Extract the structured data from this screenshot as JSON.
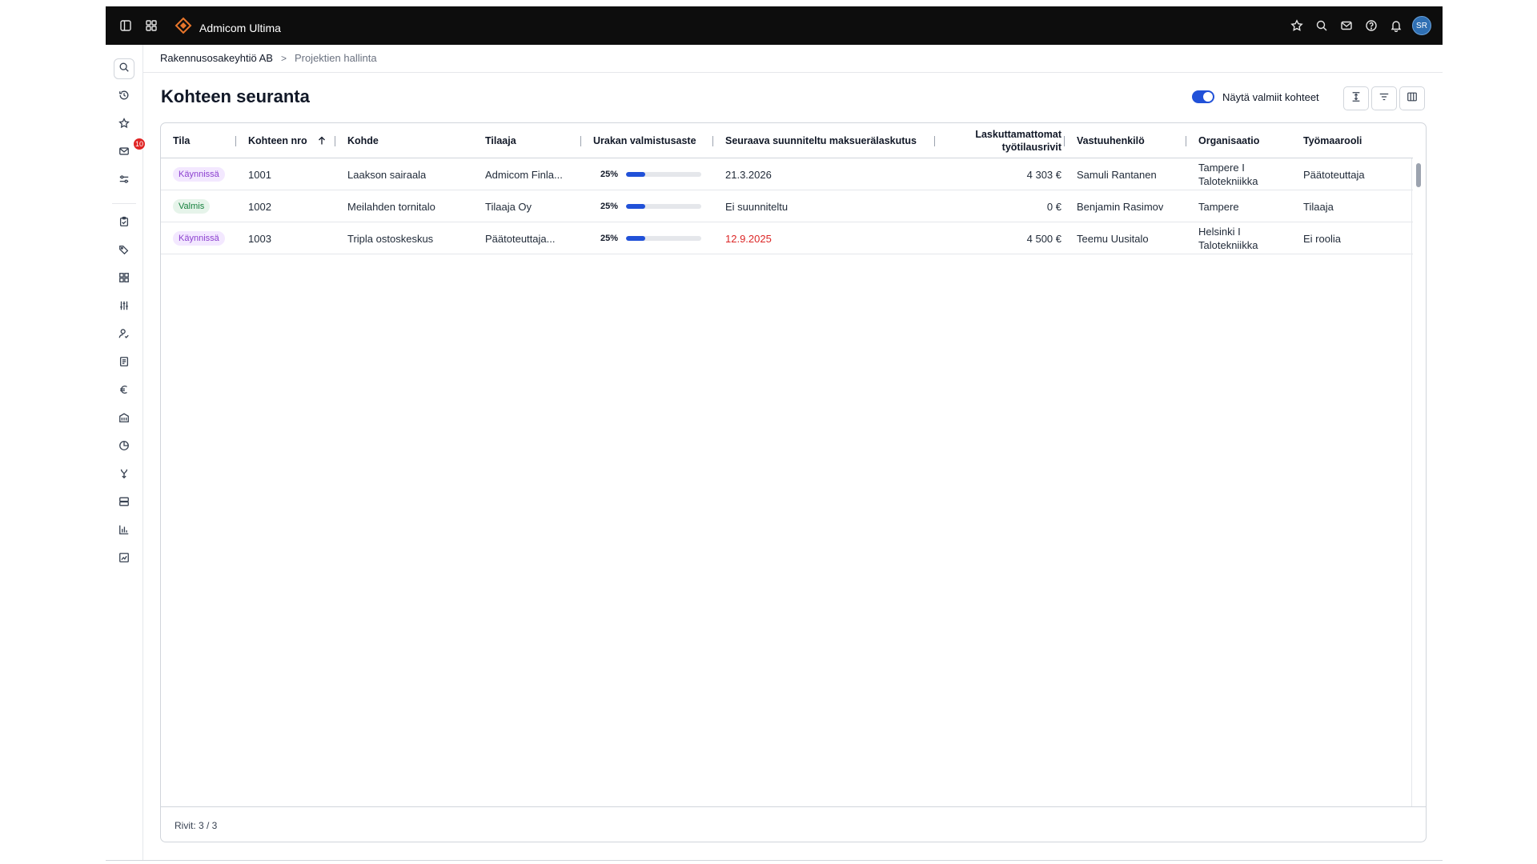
{
  "app": {
    "name": "Admicom Ultima",
    "user_initials": "SR"
  },
  "sidebar": {
    "messages_badge": "10"
  },
  "breadcrumb": {
    "company": "Rakennusosakeyhtiö AB",
    "separator": ">",
    "current": "Projektien hallinta"
  },
  "page": {
    "title": "Kohteen seuranta",
    "toggle_label": "Näytä valmiit kohteet",
    "toggle_on": true
  },
  "table": {
    "columns": {
      "tila": "Tila",
      "nro": "Kohteen nro",
      "kohde": "Kohde",
      "tilaaja": "Tilaaja",
      "valmistusaste": "Urakan valmistusaste",
      "seuraava": "Seuraava suunniteltu maksuerälaskutus",
      "laskuttamattomat_1": "Laskuttamattomat",
      "laskuttamattomat_2": "työtilausrivit",
      "vastuuhenkilo": "Vastuuhenkilö",
      "organisaatio": "Organisaatio",
      "tyomaarooli": "Työmaarooli"
    },
    "rows": [
      {
        "tila": "Käynnissä",
        "nro": "1001",
        "kohde": "Laakson sairaala",
        "tilaaja": "Admicom Finla...",
        "pct": "25%",
        "progress": 0.25,
        "seuraava": "21.3.2026",
        "laskuttamattomat": "4 303 €",
        "vastuuhenkilo": "Samuli Rantanen",
        "organisaatio": "Tampere I Talotekniikka",
        "tyomaarooli": "Päätoteuttaja"
      },
      {
        "tila": "Valmis",
        "nro": "1002",
        "kohde": "Meilahden tornitalo",
        "tilaaja": "Tilaaja Oy",
        "pct": "25%",
        "progress": 0.25,
        "seuraava": "Ei suunniteltu",
        "laskuttamattomat": "0 €",
        "vastuuhenkilo": "Benjamin Rasimov",
        "organisaatio": "Tampere",
        "tyomaarooli": "Tilaaja"
      },
      {
        "tila": "Käynnissä",
        "nro": "1003",
        "kohde": "Tripla ostoskeskus",
        "tilaaja": "Päätoteuttaja...",
        "pct": "25%",
        "progress": 0.25,
        "seuraava": "12.9.2025",
        "laskuttamattomat": "4 500 €",
        "vastuuhenkilo": "Teemu Uusitalo",
        "organisaatio": "Helsinki I Talotekniikka",
        "tyomaarooli": "Ei roolia"
      }
    ],
    "footer": "Rivit: 3 / 3"
  },
  "colors": {
    "accent": "#2151d8",
    "overdue": "#dc2626",
    "badge_running": "#8b3fcf",
    "badge_done": "#15803d"
  },
  "icons": [
    "sidebar-toggle-icon",
    "apps-grid-icon",
    "logo-icon",
    "star-icon",
    "search-icon",
    "mail-icon",
    "help-icon",
    "bell-icon",
    "history-icon",
    "sliders-icon",
    "clipboard-icon",
    "tags-icon",
    "modules-icon",
    "settings-sliders-icon",
    "user-check-icon",
    "document-icon",
    "euro-icon",
    "building-icon",
    "pie-chart-icon",
    "merge-icon",
    "server-icon",
    "bar-chart-icon",
    "line-chart-icon",
    "sort-asc-icon",
    "row-height-icon",
    "filter-icon",
    "columns-icon"
  ]
}
